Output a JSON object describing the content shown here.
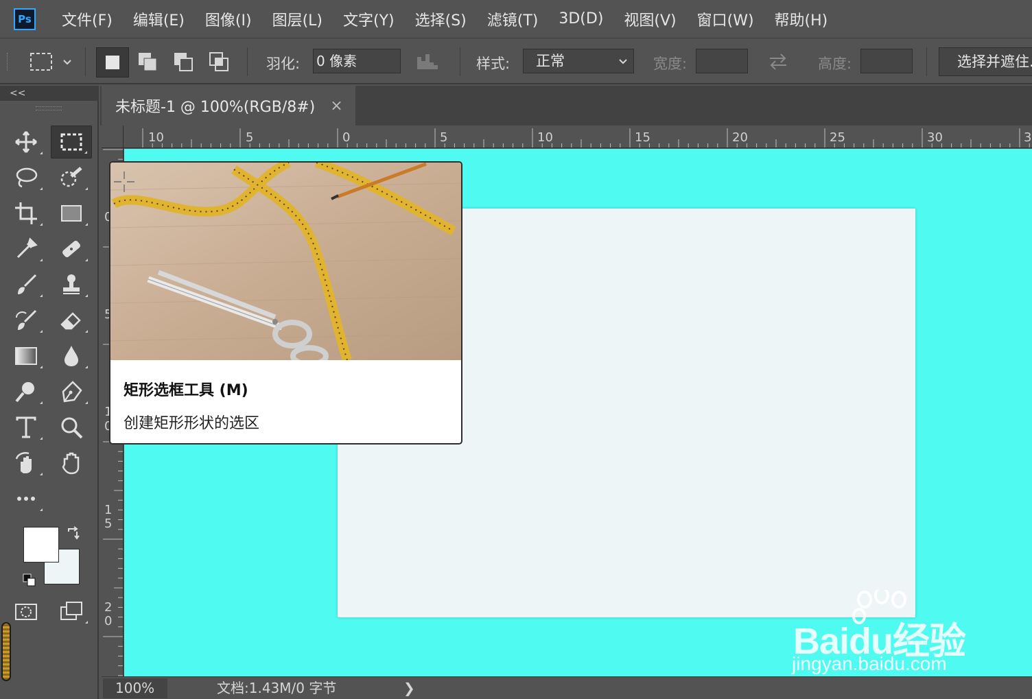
{
  "app": {
    "logo": "Ps"
  },
  "menu": [
    {
      "label": "文件(F)"
    },
    {
      "label": "编辑(E)"
    },
    {
      "label": "图像(I)"
    },
    {
      "label": "图层(L)"
    },
    {
      "label": "文字(Y)"
    },
    {
      "label": "选择(S)"
    },
    {
      "label": "滤镜(T)"
    },
    {
      "label": "3D(D)"
    },
    {
      "label": "视图(V)"
    },
    {
      "label": "窗口(W)"
    },
    {
      "label": "帮助(H)"
    }
  ],
  "options": {
    "feather_label": "羽化:",
    "feather_value": "0 像素",
    "style_label": "样式:",
    "style_value": "正常",
    "width_label": "宽度:",
    "width_value": "",
    "height_label": "高度:",
    "height_value": "",
    "select_mask_label": "选择并遮住..."
  },
  "panel": {
    "collapse_glyph": "<<"
  },
  "document_tab": {
    "title": "未标题-1 @ 100%(RGB/8#)",
    "close_glyph": "×"
  },
  "ruler": {
    "top_labels": [
      "10",
      "5",
      "0",
      "5",
      "10",
      "15",
      "20",
      "25",
      "30",
      "3"
    ],
    "left_labels": [
      "0",
      "5",
      "1\n0",
      "1\n5",
      "2\n0"
    ]
  },
  "tooltip": {
    "title": "矩形选框工具 (M)",
    "description": "创建矩形形状的选区"
  },
  "status": {
    "zoom": "100%",
    "doc_info": "文档:1.43M/0 字节",
    "arrow": "❯"
  },
  "colors": {
    "canvas_background": "#4ffaf0",
    "document_fill": "#eef5f6",
    "foreground": "#ffffff",
    "background": "#eef5f6",
    "accent": "#31a8ff"
  },
  "watermark": {
    "brand": "Baidu经验",
    "url": "jingyan.baidu.com"
  }
}
